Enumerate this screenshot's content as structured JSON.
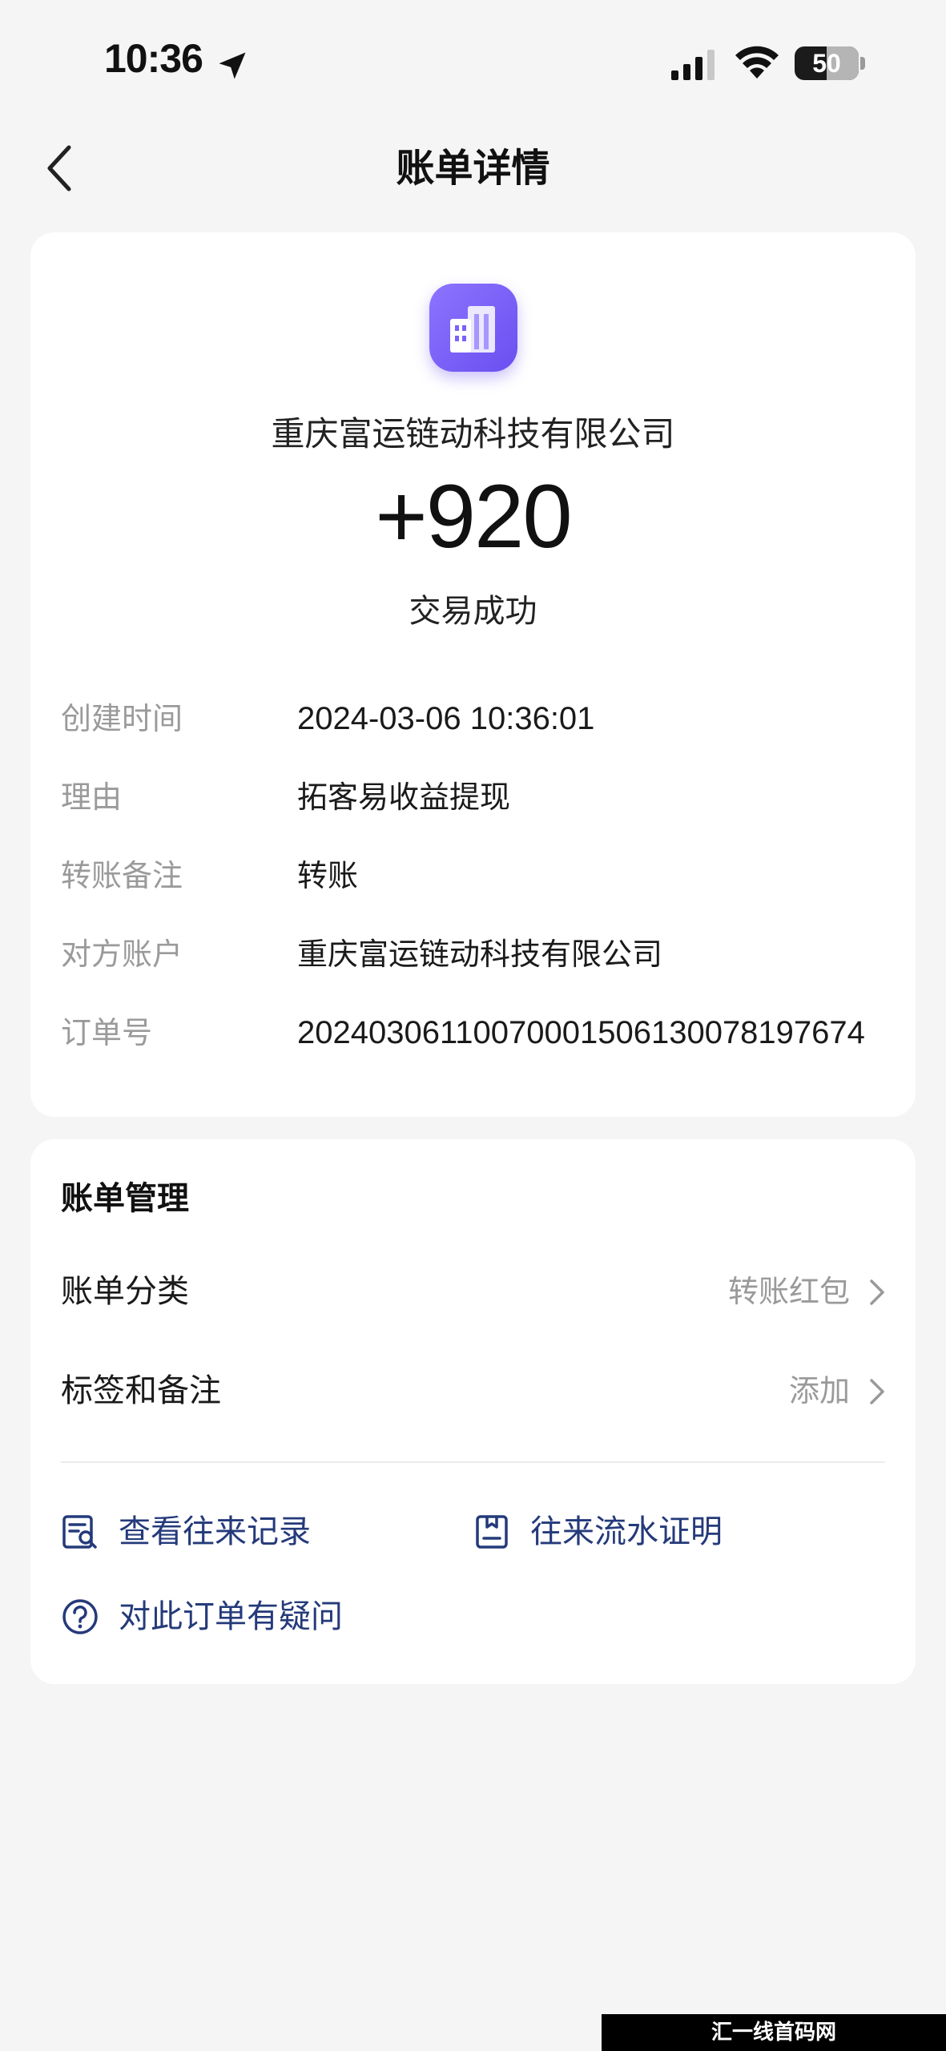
{
  "status_bar": {
    "time": "10:36",
    "battery_level": "50",
    "battery_fraction": 0.5
  },
  "nav": {
    "title": "账单详情"
  },
  "transaction": {
    "merchant_name": "重庆富运链动科技有限公司",
    "amount": "+920",
    "status": "交易成功",
    "merchant_icon": "building-icon",
    "accent_color": "#7b62f8"
  },
  "details": [
    {
      "label": "创建时间",
      "value": "2024-03-06 10:36:01"
    },
    {
      "label": "理由",
      "value": "拓客易收益提现"
    },
    {
      "label": "转账备注",
      "value": "转账"
    },
    {
      "label": "对方账户",
      "value": "重庆富运链动科技有限公司"
    },
    {
      "label": "订单号",
      "value": "20240306110070001506130078197674"
    }
  ],
  "manage": {
    "title": "账单管理",
    "rows": [
      {
        "label": "账单分类",
        "value": "转账红包"
      },
      {
        "label": "标签和备注",
        "value": "添加"
      }
    ],
    "actions": [
      {
        "label": "查看往来记录",
        "icon": "records-search-icon"
      },
      {
        "label": "往来流水证明",
        "icon": "statement-icon"
      },
      {
        "label": "对此订单有疑问",
        "icon": "question-icon"
      }
    ],
    "link_color": "#243a7a"
  },
  "watermark": "汇一线首码网 www.huiyixian.com"
}
